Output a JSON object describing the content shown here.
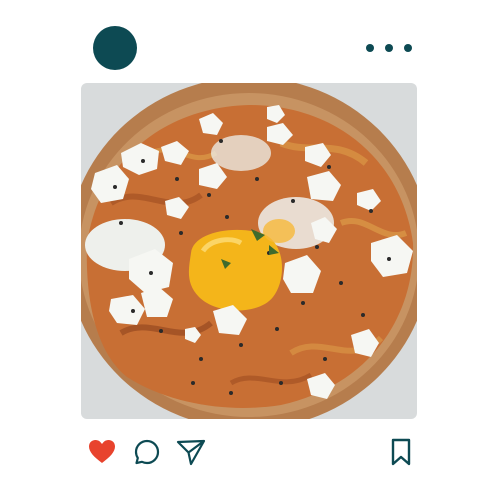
{
  "post": {
    "avatar": {
      "icon": "avatar-circle",
      "color": "#0d4a53"
    },
    "menu": {
      "icon": "more-options-icon",
      "color": "#0d4a53"
    },
    "photo": {
      "subject": "food-bowl-image",
      "colors": {
        "bowl": "#c79362",
        "bowl_rim": "#b67d4d",
        "sauce": "#c86f34",
        "cheese": "#f6f7f3",
        "yolk": "#f4b51a",
        "egg_white": "#eef0ec",
        "background": "#d8dbdc"
      }
    },
    "actions": {
      "like": {
        "icon": "heart-icon",
        "color": "#e8432d",
        "active": true
      },
      "comment": {
        "icon": "comment-icon",
        "color": "#0d4a53"
      },
      "share": {
        "icon": "send-icon",
        "color": "#0d4a53"
      },
      "save": {
        "icon": "bookmark-icon",
        "color": "#0d4a53"
      }
    }
  }
}
